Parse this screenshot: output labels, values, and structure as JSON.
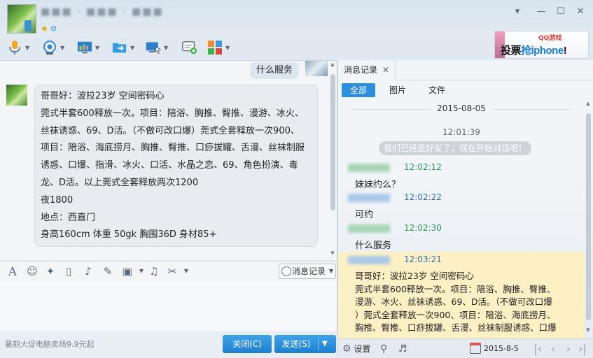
{
  "titlebar": {
    "contact_name": "■■■ · ■■■ · ■■■",
    "window_controls": [
      "▾",
      "—",
      "☐",
      "✕"
    ]
  },
  "toolbar": {
    "icons": [
      "microphone-icon",
      "video-camera-icon",
      "screen-share-icon",
      "file-transfer-icon",
      "remote-desktop-icon",
      "message-add-icon",
      "apps-grid-icon"
    ]
  },
  "ad": {
    "logo": "QQ游戏",
    "text_prefix": "投票",
    "text_highlight": "抢iphone",
    "text_suffix": "!"
  },
  "chat": {
    "sent_message": "什么服务",
    "received_lines": [
      "哥哥好：波拉23岁 空间密码心",
      "莞式半套600释放一次。项目：陪浴、胸推、臀推、漫游、冰火、",
      "丝袜诱惑、69、D活。（不做可改口爆）莞式全套释放一次900、",
      "项目：陪浴、海底捞月、胸推、臀推、口痧拔罐、舌漫、丝袜制服",
      "诱惑、口爆、指滑、冰火、口活、水晶之恋、69、角色扮演、毒",
      "龙、D活。以上莞式全套释放两次1200",
      "夜1800",
      "地点：西直门",
      "身高160cm   体重 50gk  胸围36D  身材85+"
    ]
  },
  "input_tools": {
    "history_button": "消息记录"
  },
  "bottom": {
    "promo": "暑期大促电脑卖场9.9元起",
    "close_button": "关闭(C)",
    "send_button": "发送(S)"
  },
  "history": {
    "tab_label": "消息记录",
    "filters": [
      "全部",
      "图片",
      "文件"
    ],
    "date": "2015-08-05",
    "first_time": "12:01:39",
    "system_note": "我们已经是好友了，现在开始对话吧！",
    "entries": [
      {
        "time": "12:02:12",
        "message": "妹妹约么？",
        "color": "green"
      },
      {
        "time": "12:02:22",
        "message": "可约",
        "color": "blue"
      },
      {
        "time": "12:02:30",
        "message": "什么服务",
        "color": "green"
      },
      {
        "time": "12:03:21",
        "message": "",
        "color": "blue"
      }
    ],
    "last_message_lines": [
      "哥哥好：波拉23岁 空间密码心",
      "莞式半套600释放一次。项目：陪浴、胸推、臀推、",
      "漫游、冰火、丝袜诱惑、69、D活。（不做可改口爆",
      "）莞式全套释放一次900、项目：陪浴、海底捞月、",
      "胸推、臀推、口痧拔罐、舌漫、丝袜制服诱惑、口爆"
    ]
  },
  "history_bottom": {
    "settings_label": "设置",
    "date": "2015-8-5"
  },
  "colors": {
    "accent": "#2d8fdb",
    "highlight": "#fdf0c5",
    "green_time": "#2a9a56",
    "blue_time": "#2a6fb8"
  }
}
